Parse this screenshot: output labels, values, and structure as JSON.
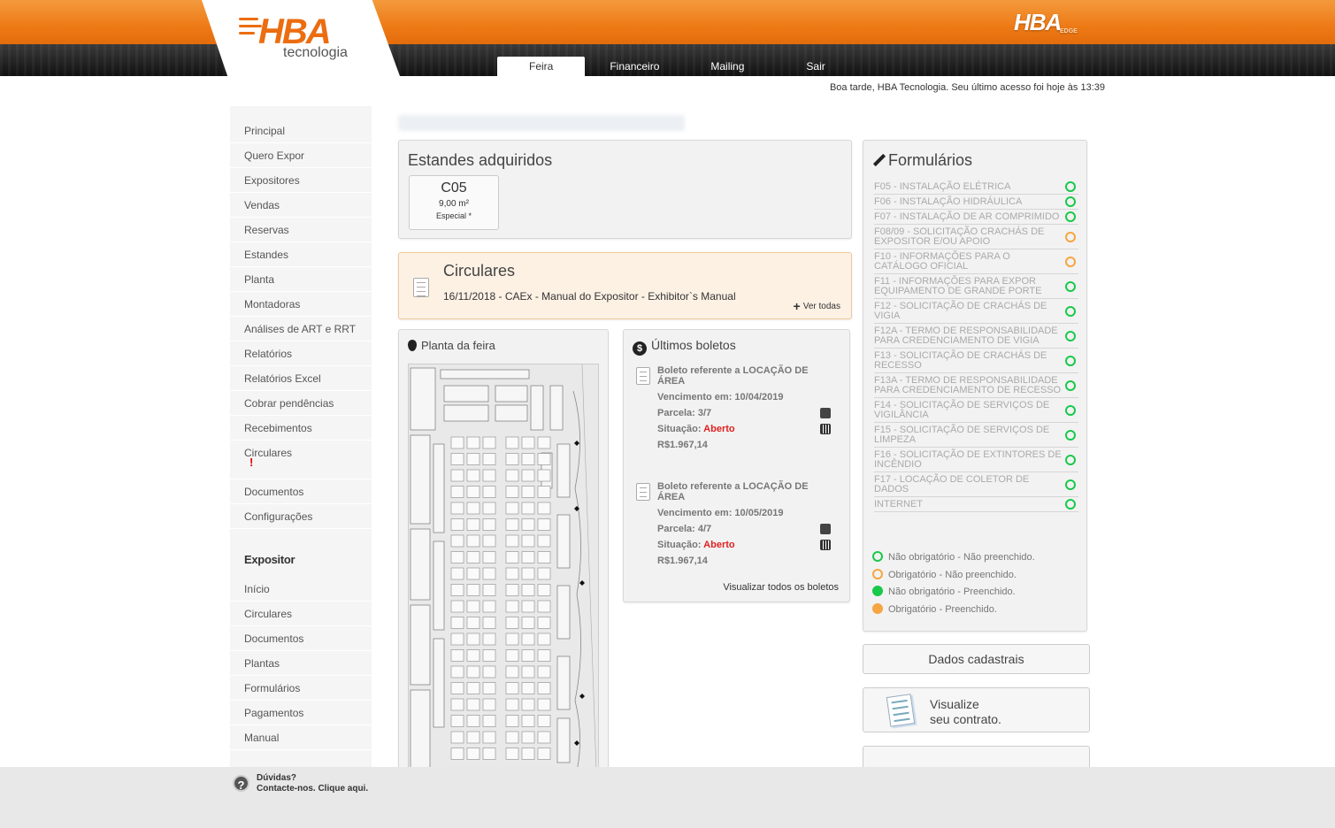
{
  "header": {
    "logo_main": "HBA",
    "logo_sub": "tecnologia",
    "logo_right": "HBA",
    "logo_right_sub": "EDGE",
    "greeting": "Boa tarde, HBA Tecnologia. Seu último acesso foi hoje às 13:39"
  },
  "topnav": {
    "tabs": [
      {
        "label": "Feira",
        "active": true
      },
      {
        "label": "Financeiro"
      },
      {
        "label": "Mailing"
      },
      {
        "label": "Sair"
      }
    ]
  },
  "sidebar": {
    "items": [
      {
        "label": "Principal"
      },
      {
        "label": "Quero Expor"
      },
      {
        "label": "Expositores"
      },
      {
        "label": "Vendas"
      },
      {
        "label": "Reservas"
      },
      {
        "label": "Estandes"
      },
      {
        "label": "Planta"
      },
      {
        "label": "Montadoras"
      },
      {
        "label": "Análises de ART e RRT"
      },
      {
        "label": "Relatórios"
      },
      {
        "label": "Relatórios Excel"
      },
      {
        "label": "Cobrar pendências"
      },
      {
        "label": "Recebimentos"
      },
      {
        "label": "Circulares",
        "alert": "!"
      },
      {
        "label": "Documentos"
      },
      {
        "label": "Configurações"
      }
    ],
    "section_title": "Expositor",
    "section_items": [
      {
        "label": "Início"
      },
      {
        "label": "Circulares"
      },
      {
        "label": "Documentos"
      },
      {
        "label": "Plantas"
      },
      {
        "label": "Formulários"
      },
      {
        "label": "Pagamentos"
      },
      {
        "label": "Manual"
      }
    ]
  },
  "estandes": {
    "title": "Estandes adquiridos",
    "stand": {
      "code": "C05",
      "area": "9,00 m²",
      "type": "Especial *"
    }
  },
  "circulares": {
    "title": "Circulares",
    "item": "16/11/2018 - CAEx - Manual do Expositor - Exhibitor`s Manual",
    "more": "Ver todas"
  },
  "planta": {
    "title": "Planta da feira"
  },
  "boletos": {
    "title": "Últimos boletos",
    "items": [
      {
        "title": "Boleto referente a LOCAÇÃO DE ÁREA",
        "due": "Vencimento em: 10/04/2019",
        "parcel": "Parcela: 3/7",
        "status_label": "Situação: ",
        "status": "Aberto",
        "amount": "R$1.967,14"
      },
      {
        "title": "Boleto referente a LOCAÇÃO DE ÁREA",
        "due": "Vencimento em: 10/05/2019",
        "parcel": "Parcela: 4/7",
        "status_label": "Situação: ",
        "status": "Aberto",
        "amount": "R$1.967,14"
      }
    ],
    "all_link": "Visualizar todos os boletos"
  },
  "formularios": {
    "title": "Formulários",
    "items": [
      {
        "label": "F05 - INSTALAÇÃO ELÉTRICA",
        "status": "green"
      },
      {
        "label": "F06 - INSTALAÇÃO HIDRÁULICA",
        "status": "green"
      },
      {
        "label": "F07 - INSTALAÇÃO DE AR COMPRIMIDO",
        "status": "green"
      },
      {
        "label": "F08/09 - SOLICITAÇÃO CRACHÁS DE EXPOSITOR E/OU APOIO",
        "status": "orange"
      },
      {
        "label": "F10 - INFORMAÇÕES PARA O CATÁLOGO OFICIAL",
        "status": "orange"
      },
      {
        "label": "F11 - INFORMAÇÕES PARA EXPOR EQUIPAMENTO DE GRANDE PORTE",
        "status": "green"
      },
      {
        "label": "F12 - SOLICITAÇÃO DE CRACHÁS DE VIGIA",
        "status": "green"
      },
      {
        "label": "F12A - TERMO DE RESPONSABILIDADE PARA CREDENCIAMENTO DE VIGIA",
        "status": "green"
      },
      {
        "label": "F13 - SOLICITAÇÃO DE CRACHÁS DE RECESSO",
        "status": "green"
      },
      {
        "label": "F13A - TERMO DE RESPONSABILIDADE PARA CREDENCIAMENTO DE RECESSO",
        "status": "green"
      },
      {
        "label": "F14 - SOLICITAÇÃO DE SERVIÇOS DE VIGILÂNCIA",
        "status": "green"
      },
      {
        "label": "F15 - SOLICITAÇÃO DE SERVIÇOS DE LIMPEZA",
        "status": "green"
      },
      {
        "label": "F16 - SOLICITAÇÃO DE EXTINTORES DE INCÊNDIO",
        "status": "green"
      },
      {
        "label": "F17 - LOCAÇÃO DE COLETOR DE DADOS",
        "status": "green"
      },
      {
        "label": "INTERNET",
        "status": "green"
      }
    ],
    "legend": [
      {
        "label": "Não obrigatório - Não preenchido.",
        "style": "green-outline"
      },
      {
        "label": "Obrigatório - Não preenchido.",
        "style": "orange-outline"
      },
      {
        "label": "Não obrigatório - Preenchido.",
        "style": "green-filled"
      },
      {
        "label": "Obrigatório - Preenchido.",
        "style": "orange-filled"
      }
    ],
    "colors": {
      "green": "#19c94a",
      "orange": "#f5a640"
    }
  },
  "dados_button": "Dados cadastrais",
  "contrato": {
    "line1": "Visualize",
    "line2": "seu contrato."
  },
  "footer": {
    "line1": "Dúvidas?",
    "line2": "Contacte-nos. Clique aqui."
  },
  "accent_color": "#ee7a16"
}
